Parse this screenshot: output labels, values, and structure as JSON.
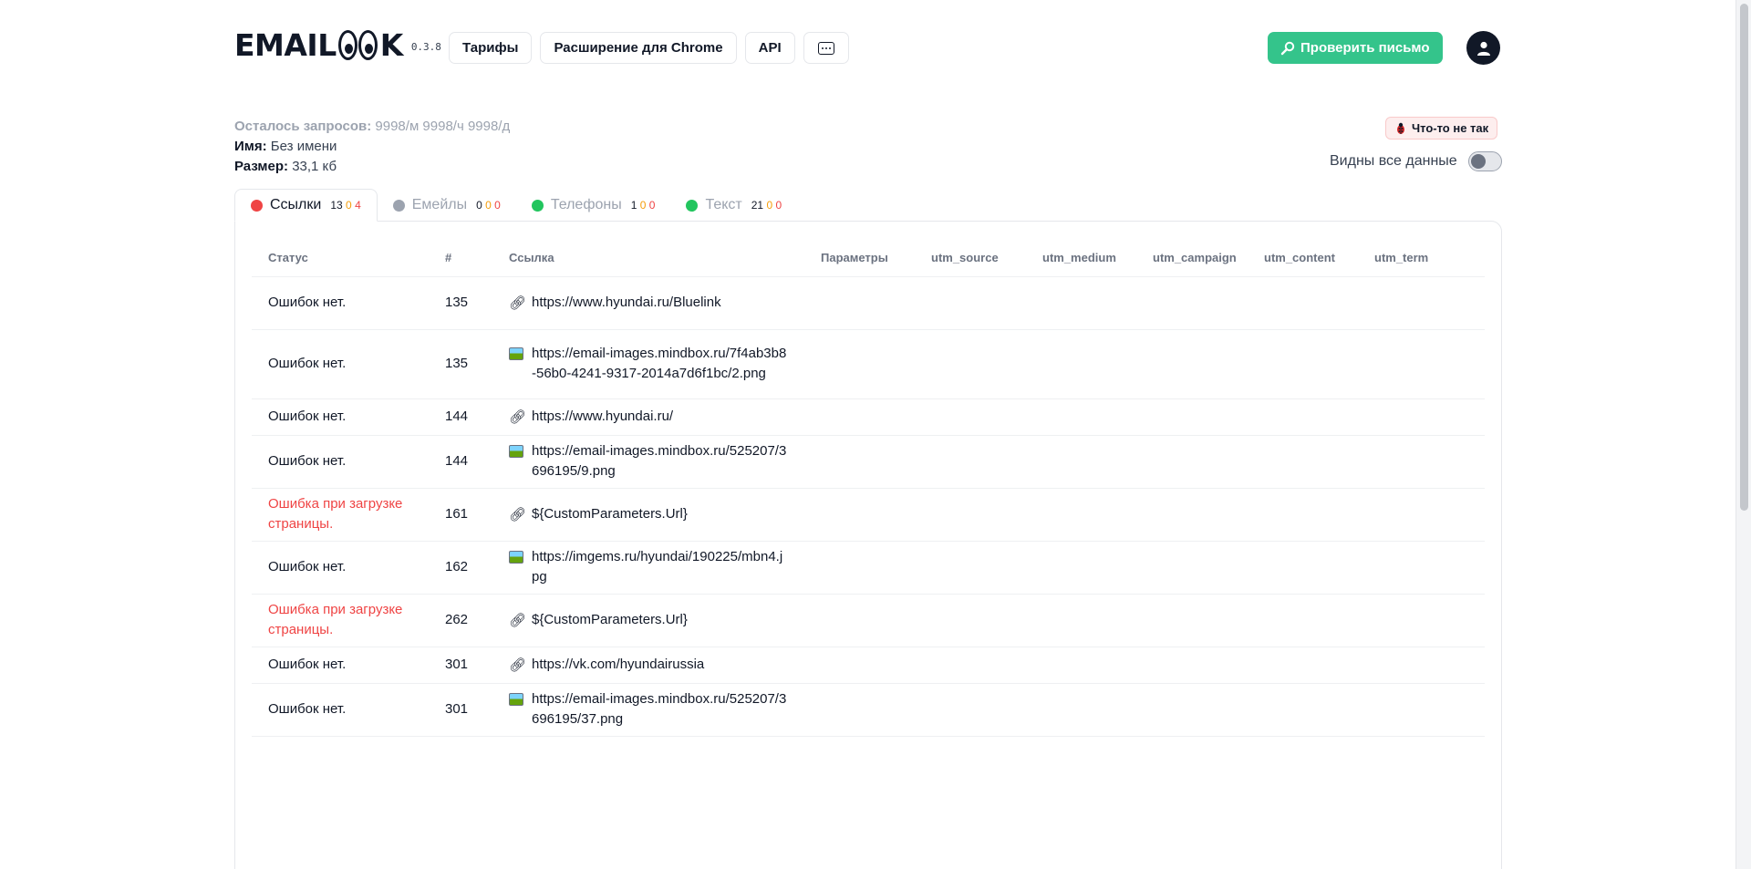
{
  "header": {
    "logo_text_left": "EMAIL",
    "logo_text_right": "K",
    "version": "0.3.8",
    "nav": [
      {
        "label": "Тарифы"
      },
      {
        "label": "Расширение для Chrome"
      },
      {
        "label": "API"
      }
    ],
    "chat_icon": "chat-bubble-icon",
    "check_button": "Проверить письмо",
    "check_icon": "magnifier-icon",
    "avatar_icon": "user-icon"
  },
  "info": {
    "requests_label": "Осталось запросов:",
    "requests_value": "9998/м 9998/ч 9998/д",
    "name_label": "Имя:",
    "name_value": "Без имени",
    "size_label": "Размер:",
    "size_value": "33,1 кб"
  },
  "report_button": "Что-то не так",
  "toggle_label": "Видны все данные",
  "toggle_on": false,
  "tabs": [
    {
      "label": "Ссылки",
      "dot_color": "#ef4444",
      "ok": "13",
      "warn": "0",
      "err": "4",
      "active": true
    },
    {
      "label": "Емейлы",
      "dot_color": "#9ca3af",
      "ok": "0",
      "warn": "0",
      "err": "0",
      "active": false
    },
    {
      "label": "Телефоны",
      "dot_color": "#22c55e",
      "ok": "1",
      "warn": "0",
      "err": "0",
      "active": false
    },
    {
      "label": "Текст",
      "dot_color": "#22c55e",
      "ok": "21",
      "warn": "0",
      "err": "0",
      "active": false
    }
  ],
  "table": {
    "columns": [
      "Статус",
      "#",
      "Ссылка",
      "Параметры",
      "utm_source",
      "utm_medium",
      "utm_campaign",
      "utm_content",
      "utm_term"
    ],
    "rows": [
      {
        "status": "Ошибок нет.",
        "error": false,
        "num": "135",
        "type": "link",
        "url": "https://www.hyundai.ru/Bluelink"
      },
      {
        "status": "Ошибок нет.",
        "error": false,
        "num": "135",
        "type": "image",
        "url": "https://email-images.mindbox.ru/7f4ab3b8-56b0-4241-9317-2014a7d6f1bc/2.png"
      },
      {
        "status": "Ошибок нет.",
        "error": false,
        "num": "144",
        "type": "link",
        "url": "https://www.hyundai.ru/"
      },
      {
        "status": "Ошибок нет.",
        "error": false,
        "num": "144",
        "type": "image",
        "url": "https://email-images.mindbox.ru/525207/3696195/9.png"
      },
      {
        "status": "Ошибка при загрузке страницы.",
        "error": true,
        "num": "161",
        "type": "link",
        "url": "${CustomParameters.Url}"
      },
      {
        "status": "Ошибок нет.",
        "error": false,
        "num": "162",
        "type": "image",
        "url": "https://imgems.ru/hyundai/190225/mbn4.jpg"
      },
      {
        "status": "Ошибка при загрузке страницы.",
        "error": true,
        "num": "262",
        "type": "link",
        "url": "${CustomParameters.Url}"
      },
      {
        "status": "Ошибок нет.",
        "error": false,
        "num": "301",
        "type": "link",
        "url": "https://vk.com/hyundairussia"
      },
      {
        "status": "Ошибок нет.",
        "error": false,
        "num": "301",
        "type": "image",
        "url": "https://email-images.mindbox.ru/525207/3696195/37.png"
      }
    ]
  }
}
